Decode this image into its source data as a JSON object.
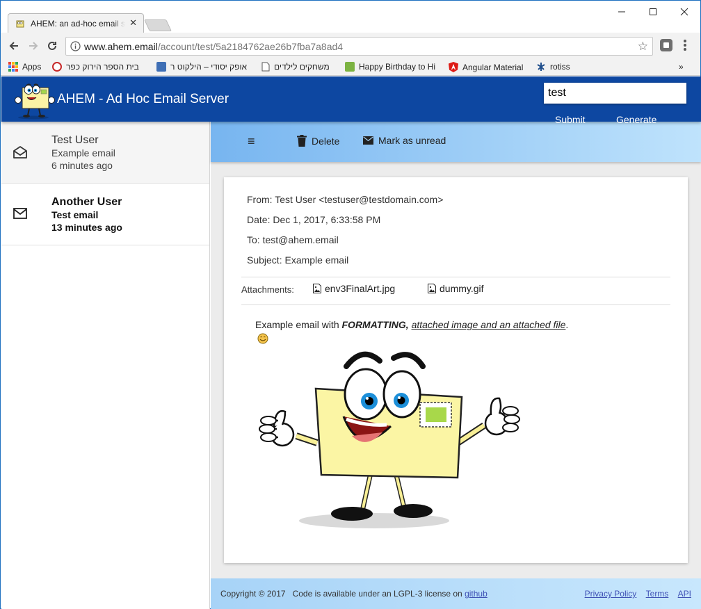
{
  "browser": {
    "tab_title": "AHEM: an ad-hoc email s",
    "url_domain": "www.ahem.email",
    "url_path": "/account/test/5a2184762ae26b7fba7a8ad4",
    "bookmarks": [
      "Apps",
      "בית הספר הירוק כפר",
      "אופק יסודי – הילקוט ר",
      "משחקים לילדים",
      "Happy Birthday to Hi",
      "Angular Material",
      "rotiss"
    ],
    "more_bookmarks": "»"
  },
  "app": {
    "title": "AHEM - Ad Hoc Email Server",
    "search_value": "test",
    "submit_label": "Submit",
    "generate_label": "Generate"
  },
  "mail_list": [
    {
      "from": "Test User",
      "subject": "Example email",
      "time": "6 minutes ago",
      "read": true
    },
    {
      "from": "Another User",
      "subject": "Test email",
      "time": "13 minutes ago",
      "read": false
    }
  ],
  "actions": {
    "menu_icon": "≡",
    "delete_label": "Delete",
    "mark_unread_label": "Mark as unread"
  },
  "email": {
    "from": "From: Test User <testuser@testdomain.com>",
    "date": "Date: Dec 1, 2017, 6:33:58 PM",
    "to": "To: test@ahem.email",
    "subject": "Subject: Example email",
    "attachments_label": "Attachments:",
    "attachments": [
      "env3FinalArt.jpg",
      "dummy.gif"
    ],
    "body_prefix": "Example email with ",
    "body_bold": "FORMATTING,",
    "body_space": " ",
    "body_link": "attached image and an attached file",
    "body_suffix": "."
  },
  "footer": {
    "copyright": "Copyright © 2017",
    "license_text": "Code is available under an LGPL-3 license on",
    "github": "github",
    "privacy": "Privacy Policy",
    "terms": "Terms",
    "api": "API"
  },
  "colors": {
    "appbar": "#0d47a1",
    "actionbar_start": "#77b5f0",
    "actionbar_end": "#bfe3fc",
    "link": "#3f51b5"
  }
}
